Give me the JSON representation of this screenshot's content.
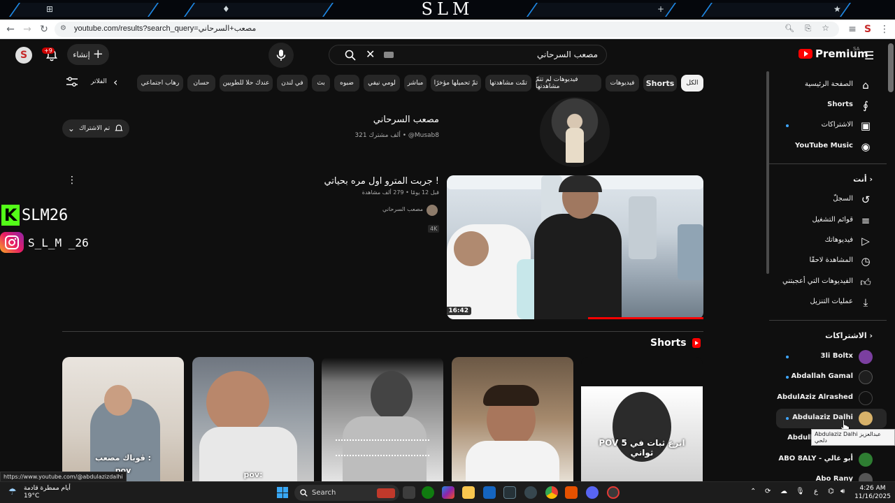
{
  "browser": {
    "title_art": "SLM",
    "tab_glyphs": [
      "⊞",
      "♦",
      "+",
      "★"
    ],
    "url": "youtube.com/results?search_query=مصعب+السرحاني"
  },
  "header": {
    "search_query": "مصعب السرحاني",
    "create_label": "إنشاء",
    "notif_count": "+9",
    "avatar_letter": "S",
    "logo_text": "Premium",
    "logo_region": "SA"
  },
  "chips": [
    "الكل",
    "Shorts",
    "فيديوهات",
    "فيديوهات لم تتمّ مشاهدتها",
    "تمّت مشاهدتها",
    "تمّ تحميلها مؤخرًا",
    "مباشر",
    "لومي نيفي",
    "ضبوه",
    "بث",
    "في لندن",
    "عندك حلا للطويين",
    "حسان",
    "رهاب اجتماعي"
  ],
  "filters_label": "الفلاتر",
  "channel": {
    "name": "مصعب السرحاني",
    "handle": "@Musab8",
    "subscribers": "321 ألف مشترك",
    "subscribed_label": "تم الاشتراك"
  },
  "video": {
    "title": "جربت المترو اول مره بحياتي !",
    "views": "279 ألف مشاهدة",
    "age": "قبل 12 يومًا",
    "channel": "مصعب السرحاني",
    "badge": "4K",
    "duration": "16:42",
    "watch_progress": 0.45
  },
  "overlay": {
    "kick_name": "SLM26",
    "kick_letter": "K",
    "instagram_name": "S_L_M _26"
  },
  "shorts": {
    "heading": "Shorts",
    "captions": [
      "ڤوباك مصعب :",
      "pov:",
      "pov",
      "",
      "POV ابرع ثبات في 5 ثواني"
    ]
  },
  "sidebar": {
    "main": [
      {
        "label": "الصفحة الرئيسية",
        "icon": "home-icon",
        "dot": false
      },
      {
        "label": "Shorts",
        "icon": "shorts-icon",
        "dot": false
      },
      {
        "label": "الاشتراكات",
        "icon": "subscriptions-icon",
        "dot": true
      },
      {
        "label": "YouTube Music",
        "icon": "music-icon",
        "dot": false
      }
    ],
    "you_heading": "أنت",
    "you": [
      {
        "label": "السجلّ",
        "icon": "history-icon"
      },
      {
        "label": "قوائم التشغيل",
        "icon": "playlist-icon"
      },
      {
        "label": "فيديوهاتك",
        "icon": "your-videos-icon"
      },
      {
        "label": "المشاهدة لاحقًا",
        "icon": "watch-later-icon"
      },
      {
        "label": "الفيديوهات التي أعجبتني",
        "icon": "like-icon"
      },
      {
        "label": "عمليات التنزيل",
        "icon": "download-icon"
      }
    ],
    "subs_heading": "الاشتراكات",
    "subs": [
      {
        "label": "3li Boltx",
        "dot": true,
        "color": "#7b3fa0"
      },
      {
        "label": "Abdallah Gamal",
        "dot": true,
        "color": "#1e1e1e"
      },
      {
        "label": "AbdulAziz Alrashed",
        "dot": false,
        "color": "#111111"
      },
      {
        "label": "Abdulaziz Dalhi",
        "dot": true,
        "color": "#d8b26a"
      },
      {
        "label": "Abdullah Alharbi",
        "dot": false,
        "color": "#8a6d5a"
      },
      {
        "label": "ABO 8ALY - أبو غالي",
        "dot": false,
        "color": "#2e7d32"
      },
      {
        "label": "Abo Rany",
        "dot": false,
        "color": "#555555"
      }
    ]
  },
  "tooltip": "Abdulaziz Dalhi عبدالعزيز دلحي",
  "status_link": "https://www.youtube.com/@abdulazizdalhi",
  "taskbar": {
    "weather_line1": "أيام ممطرة قادمة",
    "weather_line2": "19°C",
    "search_label": "Search",
    "time": "4:26 AM",
    "date": "11/16/2025",
    "lang": "ع"
  }
}
